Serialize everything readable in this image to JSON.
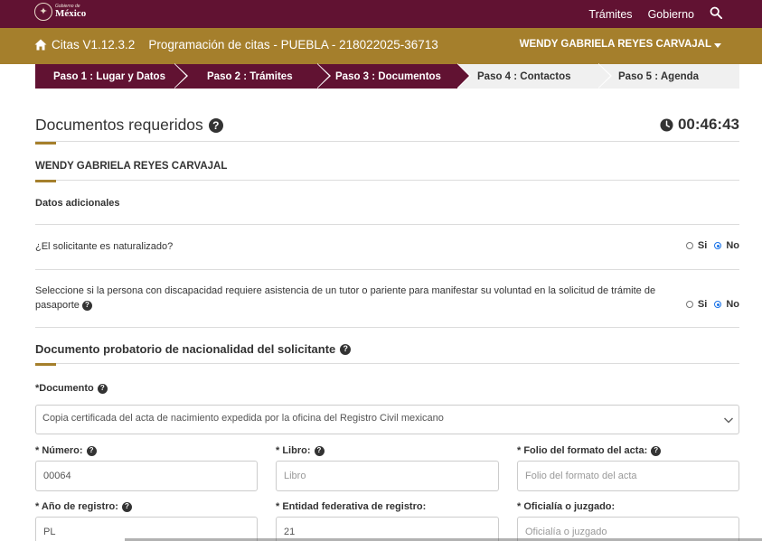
{
  "topbar": {
    "logo_line1": "Gobierno de",
    "logo_line2": "México",
    "nav": [
      "Trámites",
      "Gobierno"
    ],
    "search_icon": "search-icon"
  },
  "header": {
    "app_version": "Citas V1.12.3.2",
    "app_title": "Programación de citas - PUEBLA - 218022025-36713",
    "user_name": "WENDY GABRIELA REYES CARVAJAL",
    "home_icon": "home-icon"
  },
  "steps": [
    {
      "label": "Paso 1 : Lugar y Datos",
      "state": "done"
    },
    {
      "label": "Paso 2 : Trámites",
      "state": "done"
    },
    {
      "label": "Paso 3 : Documentos",
      "state": "done"
    },
    {
      "label": "Paso 4 : Contactos",
      "state": "todo"
    },
    {
      "label": "Paso 5 : Agenda",
      "state": "todo"
    }
  ],
  "page": {
    "title": "Documentos requeridos",
    "timer": "00:46:43",
    "person": "WENDY GABRIELA REYES CARVAJAL",
    "additional": "Datos adicionales"
  },
  "questions": {
    "naturalized": "¿El solicitante es naturalizado?",
    "disability_line1": "Seleccione si la persona con discapacidad requiere asistencia de un tutor o pariente para manifestar su voluntad en la solicitud de trámite de",
    "disability_line2": "pasaporte",
    "yes": "Si",
    "no": "No",
    "naturalized_value": "No",
    "disability_value": "No"
  },
  "document_section": {
    "title": "Documento probatorio de nacionalidad del solicitante",
    "doc_label": "*Documento",
    "doc_value": "Copia certificada del acta de nacimiento expedida por la oficina del Registro Civil mexicano"
  },
  "fields": {
    "numero": {
      "label": "* Número:",
      "value": "00064"
    },
    "libro": {
      "label": "* Libro:",
      "placeholder": "Libro"
    },
    "folio": {
      "label": "* Folio del formato del acta:",
      "placeholder": "Folio del formato del acta"
    },
    "anio": {
      "label": "* Año de registro:",
      "value": "PL"
    },
    "entidad": {
      "label": "* Entidad federativa de registro:",
      "value": "21"
    },
    "oficialia": {
      "label": "* Oficialía o juzgado:",
      "placeholder": "Oficialía o juzgado"
    }
  },
  "colors": {
    "guinda": "#611232",
    "gold": "#a57f2c",
    "radio_selected": "#1a73e8"
  }
}
